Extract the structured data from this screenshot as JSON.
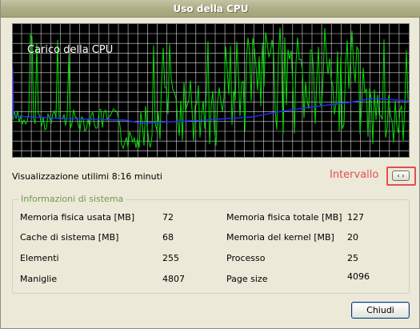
{
  "window": {
    "title": "Uso della CPU"
  },
  "graph": {
    "label": "Carico della CPU",
    "background_color": "#000000",
    "grid_color": "#ffffff",
    "cpu_line_color": "#00e000",
    "average_line_color": "#2a2aff"
  },
  "view_info": "Visualizzazione utilimi 8:16 minuti",
  "interval": {
    "label": "Intervallo",
    "button_label": "‹ ›",
    "highlight_color": "#e05050"
  },
  "system_info": {
    "title": "Informazioni di sistema",
    "rows": [
      {
        "label1": "Memoria fisica usata [MB]",
        "value1": "72",
        "label2": "Memoria fisica totale [MB]",
        "value2": "127"
      },
      {
        "label1": "Cache di sistema [MB]",
        "value1": "68",
        "label2": "Memoria del kernel [MB]",
        "value2": "20"
      },
      {
        "label1": "Elementi",
        "value1": "255",
        "label2": "Processo",
        "value2": "25"
      },
      {
        "label1": "Maniglie",
        "value1": "4807",
        "label2": "Page size",
        "value2": "4096"
      }
    ]
  },
  "buttons": {
    "close_label": "Chiudi"
  }
}
